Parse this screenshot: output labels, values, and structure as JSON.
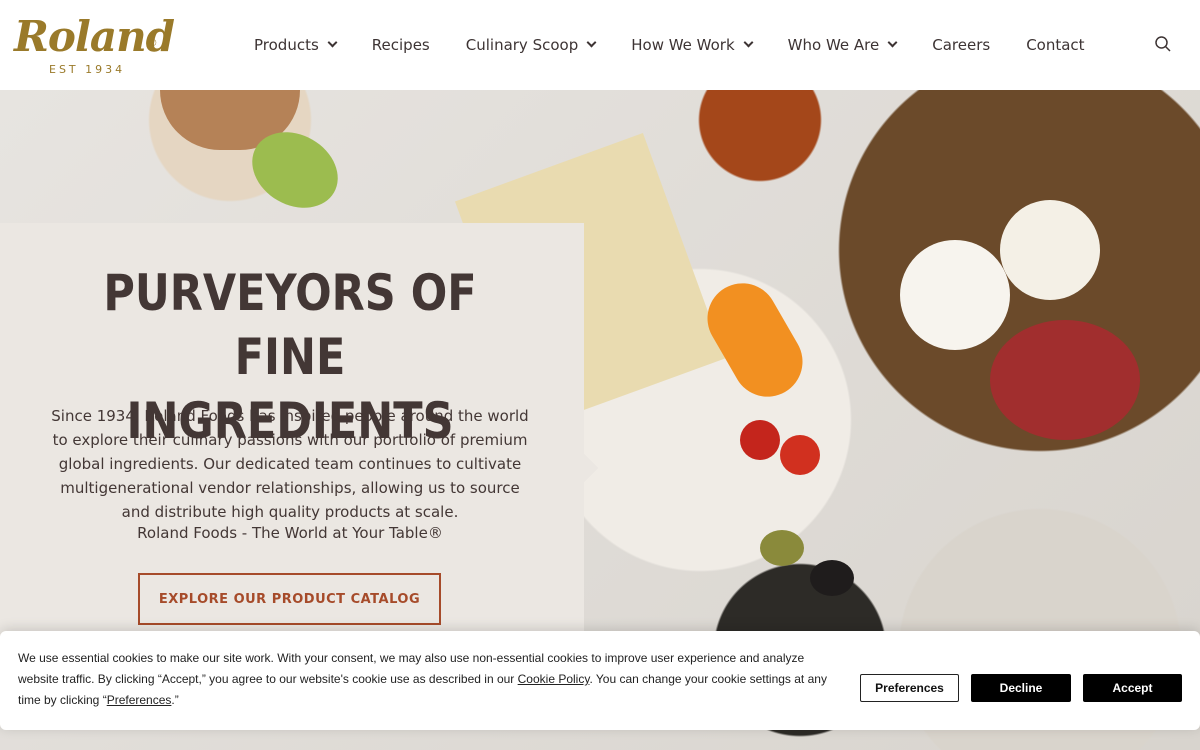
{
  "header": {
    "logo": {
      "word": "Roland",
      "reg": "®",
      "est": "EST 1934"
    },
    "nav": [
      {
        "label": "Products",
        "dropdown": true
      },
      {
        "label": "Recipes",
        "dropdown": false
      },
      {
        "label": "Culinary Scoop",
        "dropdown": true
      },
      {
        "label": "How We Work",
        "dropdown": true
      },
      {
        "label": "Who We Are",
        "dropdown": true
      },
      {
        "label": "Careers",
        "dropdown": false
      },
      {
        "label": "Contact",
        "dropdown": false
      }
    ],
    "search_icon": "search-icon"
  },
  "hero": {
    "title_line1": "PURVEYORS OF FINE",
    "title_line2": "INGREDIENTS",
    "body": "Since 1934, Roland Foods has inspired people around the world to explore their culinary passions with our portfolio of premium global ingredients. Our dedicated team continues to cultivate multigenerational vendor relationships, allowing us to source and distribute high quality products at scale.",
    "tagline": "Roland Foods - The World at Your Table®",
    "cta_label": "EXPLORE OUR PRODUCT CATALOG"
  },
  "cookie": {
    "text_1": "We use essential cookies to make our site work. With your consent, we may also use non-essential cookies to improve user experience and analyze website traffic. By clicking “Accept,” you agree to our website's cookie use as described in our ",
    "policy_link": "Cookie Policy",
    "text_2": ". You can change your cookie settings at any time by clicking “",
    "pref_link": "Preferences",
    "text_3": ".”",
    "buttons": {
      "preferences": "Preferences",
      "decline": "Decline",
      "accept": "Accept"
    }
  },
  "colors": {
    "brand_gold": "#9a7a2a",
    "text_dark": "#433735",
    "cta_rust": "#a64b2a",
    "card_bg": "#ebe7e2"
  }
}
